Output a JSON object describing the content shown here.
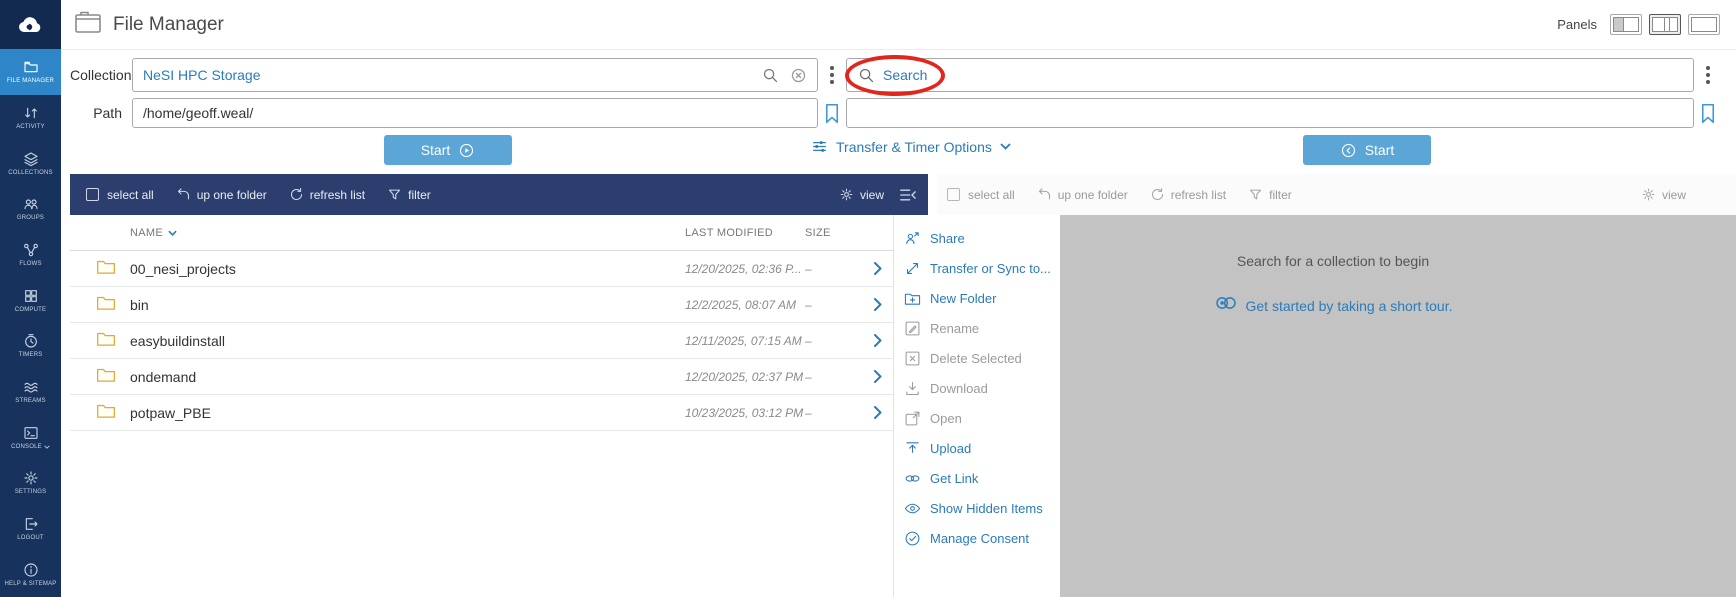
{
  "app": {
    "title": "File Manager",
    "panels_label": "Panels"
  },
  "colors": {
    "accent_blue": "#2b7bb9",
    "sidebar_navy": "#17325c",
    "sidebar_active_blue": "#2e86c8",
    "toolbar_navy": "#2c3e6e",
    "start_button_blue": "#5ba6d6",
    "annotation_red": "#e1261d",
    "folder_yellow": "#dfa934",
    "detail_pane_gray": "#c3c3c3"
  },
  "sidebar": {
    "items": [
      {
        "label": "FILE MANAGER",
        "icon": "file-manager-icon",
        "active": true
      },
      {
        "label": "ACTIVITY",
        "icon": "activity-icon",
        "active": false
      },
      {
        "label": "COLLECTIONS",
        "icon": "collections-icon",
        "active": false
      },
      {
        "label": "GROUPS",
        "icon": "groups-icon",
        "active": false
      },
      {
        "label": "FLOWS",
        "icon": "flows-icon",
        "active": false
      },
      {
        "label": "COMPUTE",
        "icon": "compute-icon",
        "active": false
      },
      {
        "label": "TIMERS",
        "icon": "timers-icon",
        "active": false
      },
      {
        "label": "STREAMS",
        "icon": "streams-icon",
        "active": false
      },
      {
        "label": "CONSOLE",
        "icon": "console-icon",
        "active": false,
        "has_chevron": true
      },
      {
        "label": "SETTINGS",
        "icon": "settings-icon",
        "active": false
      },
      {
        "label": "LOGOUT",
        "icon": "logout-icon",
        "active": false
      },
      {
        "label": "HELP & SITEMAP",
        "icon": "help-icon",
        "active": false
      }
    ]
  },
  "left_panel": {
    "collection_label": "Collection",
    "collection_value": "NeSI HPC Storage",
    "path_label": "Path",
    "path_value": "/home/geoff.weal/",
    "start_button": "Start"
  },
  "transfer_options": {
    "label": "Transfer & Timer Options"
  },
  "right_panel": {
    "search_placeholder": "Search",
    "path_value": "",
    "start_button": "Start",
    "empty_state": {
      "message": "Search for a collection to begin",
      "tour_link": "Get started by taking a short tour."
    }
  },
  "toolbar": {
    "select_all": "select all",
    "up_one_folder": "up one folder",
    "refresh_list": "refresh list",
    "filter": "filter",
    "view": "view"
  },
  "file_list": {
    "columns": {
      "name": "NAME",
      "last_modified": "LAST MODIFIED",
      "size": "SIZE"
    },
    "rows": [
      {
        "name": "00_nesi_projects",
        "last_modified": "12/20/2025, 02:36 P...",
        "size": "–"
      },
      {
        "name": "bin",
        "last_modified": "12/2/2025, 08:07 AM",
        "size": "–"
      },
      {
        "name": "easybuildinstall",
        "last_modified": "12/11/2025, 07:15 AM",
        "size": "–"
      },
      {
        "name": "ondemand",
        "last_modified": "12/20/2025, 02:37 PM",
        "size": "–"
      },
      {
        "name": "potpaw_PBE",
        "last_modified": "10/23/2025, 03:12 PM",
        "size": "–"
      }
    ]
  },
  "action_menu": {
    "items": [
      {
        "label": "Share",
        "icon": "share-icon",
        "enabled": true
      },
      {
        "label": "Transfer or Sync to...",
        "icon": "transfer-icon",
        "enabled": true
      },
      {
        "label": "New Folder",
        "icon": "new-folder-icon",
        "enabled": true
      },
      {
        "label": "Rename",
        "icon": "rename-icon",
        "enabled": false
      },
      {
        "label": "Delete Selected",
        "icon": "delete-icon",
        "enabled": false
      },
      {
        "label": "Download",
        "icon": "download-icon",
        "enabled": false
      },
      {
        "label": "Open",
        "icon": "open-icon",
        "enabled": false
      },
      {
        "label": "Upload",
        "icon": "upload-icon",
        "enabled": true
      },
      {
        "label": "Get Link",
        "icon": "get-link-icon",
        "enabled": true
      },
      {
        "label": "Show Hidden Items",
        "icon": "show-hidden-icon",
        "enabled": true
      },
      {
        "label": "Manage Consent",
        "icon": "manage-consent-icon",
        "enabled": true
      }
    ]
  }
}
